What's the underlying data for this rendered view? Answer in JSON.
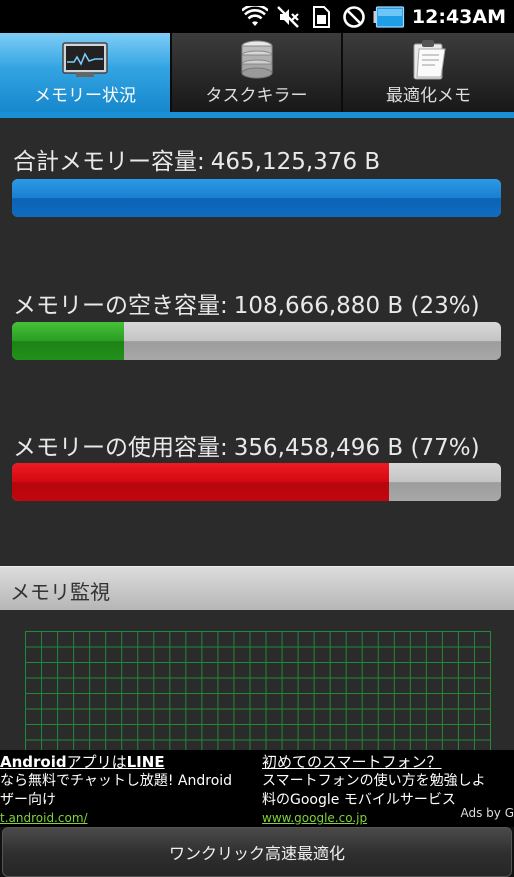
{
  "status_bar": {
    "time": "12:43AM",
    "icons": [
      "wifi-icon",
      "mute-icon",
      "sim-icon",
      "no-sync-icon",
      "battery-icon"
    ]
  },
  "tabs": [
    {
      "label": "メモリー状況",
      "icon": "monitor-icon",
      "active": true
    },
    {
      "label": "タスクキラー",
      "icon": "database-icon",
      "active": false
    },
    {
      "label": "最適化メモ",
      "icon": "clipboard-icon",
      "active": false
    }
  ],
  "memory": {
    "total": {
      "label": "合計メモリー容量:",
      "value": "465,125,376 B",
      "fraction": 1.0
    },
    "free": {
      "label": "メモリーの空き容量:",
      "value": "108,666,880 B (23%)",
      "fraction": 0.23
    },
    "used": {
      "label": "メモリーの使用容量:",
      "value": "356,458,496 B (77%)",
      "fraction": 0.77
    }
  },
  "colors": {
    "total_bar": "#1a7fd0",
    "free_bar": "#2a9e22",
    "used_bar": "#d20a12",
    "tab_active": "#32a4e2",
    "graph_grid": "#1f8a3a"
  },
  "monitor": {
    "title": "メモリ監視"
  },
  "ads": [
    {
      "title_bold": "Android",
      "title_rest": "アプリは",
      "title_bold2": "LINE",
      "line1": "なら無料でチャットし放題! Android",
      "line2": "ザー向け",
      "url": "t.android.com/"
    },
    {
      "title": "初めてのスマートフォン？",
      "line1": "スマートフォンの使い方を勉強しよ",
      "line2": "料のGoogle モバイルサービス",
      "url": "www.google.co.jp"
    }
  ],
  "ads_by": "Ads by G",
  "bottom_button": {
    "label": "ワンクリック高速最適化"
  }
}
